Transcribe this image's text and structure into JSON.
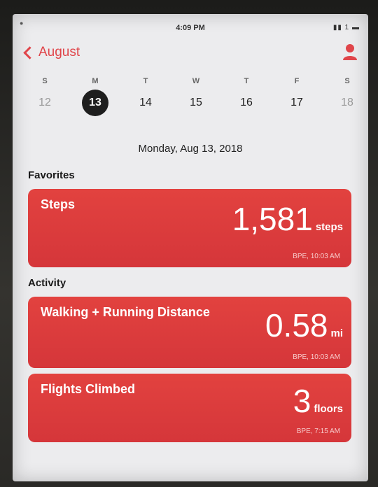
{
  "status_bar": {
    "time": "4:09 PM",
    "left": "●",
    "right": "▮▮ 1 ▬"
  },
  "nav": {
    "back_label": "August",
    "profile_icon": "person-icon"
  },
  "week": {
    "letters": [
      "S",
      "M",
      "T",
      "W",
      "T",
      "F",
      "S"
    ],
    "dates": [
      "12",
      "13",
      "14",
      "15",
      "16",
      "17",
      "18"
    ],
    "selected_index": 1
  },
  "date_label": "Monday, Aug 13, 2018",
  "favorites": {
    "header": "Favorites",
    "steps": {
      "title": "Steps",
      "value": "1,581",
      "unit": "steps",
      "time": "BPE, 10:03 AM"
    }
  },
  "activity": {
    "header": "Activity",
    "distance": {
      "title": "Walking + Running Distance",
      "value": "0.58",
      "unit": "mi",
      "time": "BPE, 10:03 AM"
    },
    "flights": {
      "title": "Flights Climbed",
      "value": "3",
      "unit": "floors",
      "time": "BPE, 7:15 AM"
    }
  },
  "colors": {
    "accent": "#e0454a",
    "card": "#d93a3b"
  }
}
